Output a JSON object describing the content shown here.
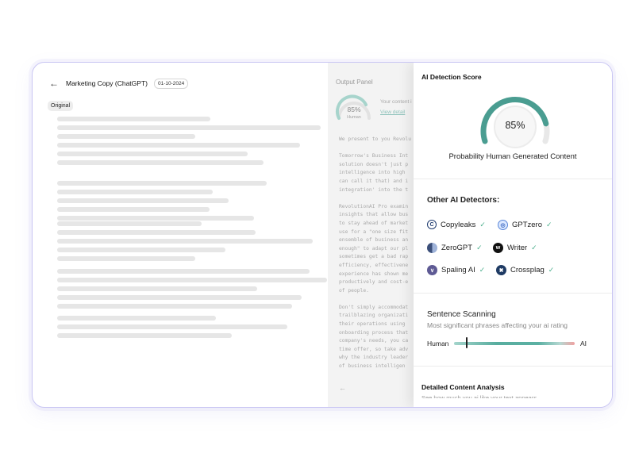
{
  "document": {
    "title": "Marketing Copy (ChatGPT)",
    "date": "01-10-2024",
    "chip": "Original"
  },
  "output_panel": {
    "title": "Output Panel",
    "gauge_percent": "85%",
    "gauge_label": "Human",
    "content_text": "Your content i",
    "view_details": "View detail",
    "text": "We present to you Revolu\n\nTomorrow's Business Int\nsolution doesn't just p\nintelligence into high \ncan call it that) and i\nintegration' into the t\n\nRevolutionAI Pro examin\ninsights that allow bus\nto stay ahead of market\nuse for a \"one size fit\nensemble of business an\nenough\" to adapt our pl\nsometimes get a bad rap\nefficiency, effectivene\nexperience has shown me\nproductively and cost-e\nof people.\n\nDon't simply accommodat\ntrailblazing organizati\ntheir operations using \nonboarding process that\ncompany's needs, you ca\ntime offer, so take adv\nwhy the industry leader\nof business intelligen"
  },
  "detection": {
    "title": "AI Detection Score",
    "score": "85%",
    "score_value": 0.85,
    "probability_label": "Probability Human Generated Content",
    "other_title": "Other AI Detectors:",
    "detectors": [
      {
        "name": "Copyleaks",
        "icon": "copyleaks-icon"
      },
      {
        "name": "GPTzero",
        "icon": "gptzero-icon"
      },
      {
        "name": "ZeroGPT",
        "icon": "zerogpt-icon"
      },
      {
        "name": "Writer",
        "icon": "writer-icon"
      },
      {
        "name": "Spaling AI",
        "icon": "spaling-icon"
      },
      {
        "name": "Crossplag",
        "icon": "crossplag-icon"
      }
    ],
    "check": "✓",
    "scanning": {
      "title": "Sentence Scanning",
      "subtitle": "Most significant phrases affecting your ai rating",
      "left_label": "Human",
      "right_label": "AI",
      "marker_position": 0.1
    },
    "analysis": {
      "title": "Detailed Content Analysis",
      "subtitle": "See how much you ai like your text appears"
    }
  },
  "colors": {
    "accent": "#4a9d91",
    "window_border": "#c9c6f3",
    "check": "#4caf8d"
  }
}
